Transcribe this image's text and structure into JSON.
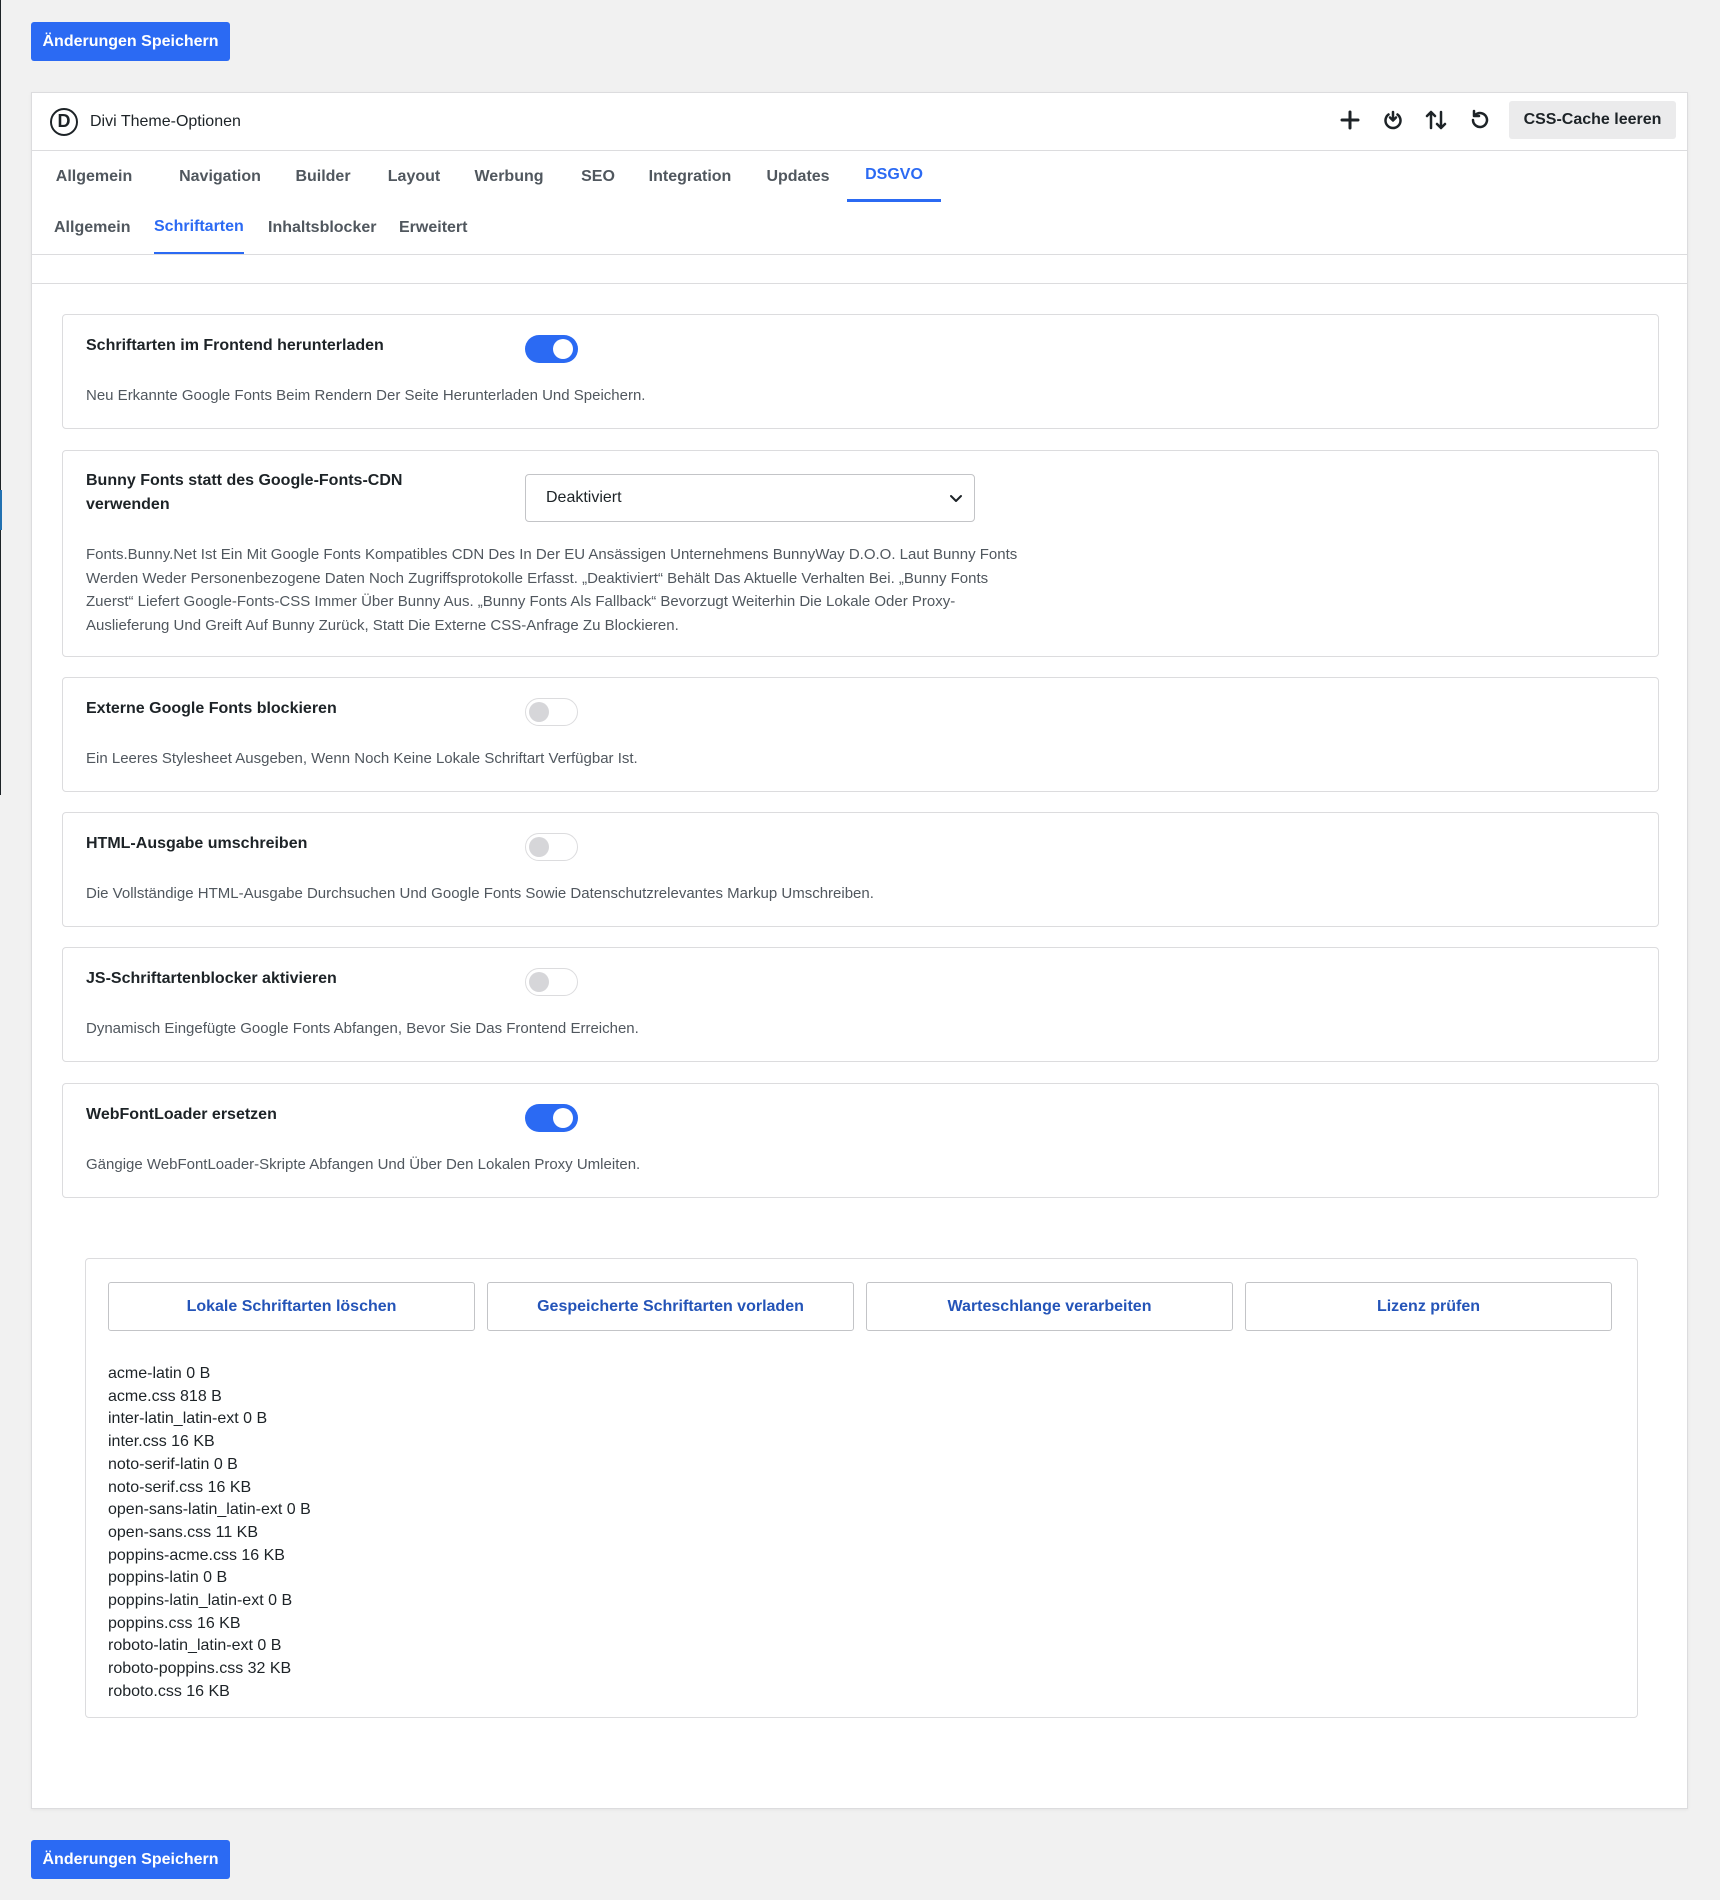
{
  "save_button": "Änderungen Speichern",
  "header": {
    "logo_letter": "D",
    "title": "Divi Theme-Optionen",
    "icons": [
      "plus-icon",
      "power-icon",
      "sort-icon",
      "undo-icon"
    ],
    "cache_button": "CSS-Cache leeren"
  },
  "main_tabs": [
    "Allgemein",
    "Navigation",
    "Builder",
    "Layout",
    "Werbung",
    "SEO",
    "Integration",
    "Updates",
    "DSGVO"
  ],
  "main_tab_active": "DSGVO",
  "sub_tabs": [
    "Allgemein",
    "Schriftarten",
    "Inhaltsblocker",
    "Erweitert"
  ],
  "sub_tab_active": "Schriftarten",
  "settings": [
    {
      "label": "Schriftarten im Frontend herunterladen",
      "control": "toggle",
      "enabled": true,
      "description": "Neu Erkannte Google Fonts Beim Rendern Der Seite Herunterladen Und Speichern."
    },
    {
      "label": "Bunny Fonts statt des Google-Fonts-CDN verwenden",
      "control": "select",
      "selected": "Deaktiviert",
      "description": "Fonts.Bunny.Net Ist Ein Mit Google Fonts Kompatibles CDN Des In Der EU Ansässigen Unternehmens BunnyWay D.O.O. Laut Bunny Fonts Werden Weder Personenbezogene Daten Noch Zugriffsprotokolle Erfasst. „Deaktiviert“ Behält Das Aktuelle Verhalten Bei. „Bunny Fonts Zuerst“ Liefert Google-Fonts-CSS Immer Über Bunny Aus. „Bunny Fonts Als Fallback“ Bevorzugt Weiterhin Die Lokale Oder Proxy-Auslieferung Und Greift Auf Bunny Zurück, Statt Die Externe CSS-Anfrage Zu Blockieren."
    },
    {
      "label": "Externe Google Fonts blockieren",
      "control": "toggle",
      "enabled": false,
      "description": "Ein Leeres Stylesheet Ausgeben, Wenn Noch Keine Lokale Schriftart Verfügbar Ist."
    },
    {
      "label": "HTML-Ausgabe umschreiben",
      "control": "toggle",
      "enabled": false,
      "description": "Die Vollständige HTML-Ausgabe Durchsuchen Und Google Fonts Sowie Datenschutzrelevantes Markup Umschreiben."
    },
    {
      "label": "JS-Schriftartenblocker aktivieren",
      "control": "toggle",
      "enabled": false,
      "description": "Dynamisch Eingefügte Google Fonts Abfangen, Bevor Sie Das Frontend Erreichen."
    },
    {
      "label": "WebFontLoader ersetzen",
      "control": "toggle",
      "enabled": true,
      "description": "Gängige WebFontLoader-Skripte Abfangen Und Über Den Lokalen Proxy Umleiten."
    }
  ],
  "tools": {
    "buttons": [
      "Lokale Schriftarten löschen",
      "Gespeicherte Schriftarten vorladen",
      "Warteschlange verarbeiten",
      "Lizenz prüfen"
    ],
    "fonts": [
      "acme-latin 0 B",
      "acme.css 818 B",
      "inter-latin_latin-ext 0 B",
      "inter.css 16 KB",
      "noto-serif-latin 0 B",
      "noto-serif.css 16 KB",
      "open-sans-latin_latin-ext 0 B",
      "open-sans.css 11 KB",
      "poppins-acme.css 16 KB",
      "poppins-latin 0 B",
      "poppins-latin_latin-ext 0 B",
      "poppins.css 16 KB",
      "roboto-latin_latin-ext 0 B",
      "roboto-poppins.css 32 KB",
      "roboto.css 16 KB"
    ]
  },
  "colors": {
    "accent": "#2b6af3",
    "toggle_off": "#d6d6d9",
    "text": "#1d2327",
    "muted": "#50575e"
  }
}
